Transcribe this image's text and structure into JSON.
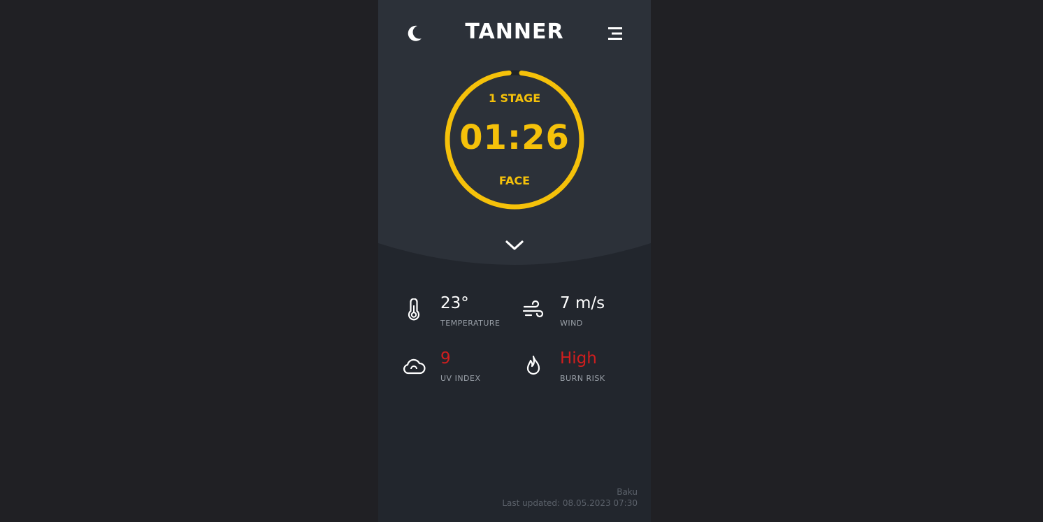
{
  "header": {
    "title": "TANNER",
    "left_icon": "moon-icon",
    "right_icon": "menu-icon"
  },
  "timer": {
    "stage": "1 STAGE",
    "time": "01:26",
    "zone": "FACE",
    "progress": 0.97,
    "color": "#f5c10a"
  },
  "expand_icon": "chevron-down-icon",
  "stats": {
    "temperature": {
      "value": "23°",
      "label": "TEMPERATURE",
      "icon": "thermometer-icon"
    },
    "wind": {
      "value": "7 m/s",
      "label": "WIND",
      "icon": "wind-icon"
    },
    "uv": {
      "value": "9",
      "label": "UV INDEX",
      "icon": "cloud-sun-icon"
    },
    "burn": {
      "value": "High",
      "label": "BURN RISK",
      "icon": "flame-icon"
    }
  },
  "footer": {
    "city": "Baku",
    "updated": "Last updated: 08.05.2023 07:30"
  },
  "colors": {
    "accent": "#f5c10a",
    "danger": "#d01e1e",
    "panel_top": "#2c3139",
    "panel_bottom": "#22262d"
  }
}
